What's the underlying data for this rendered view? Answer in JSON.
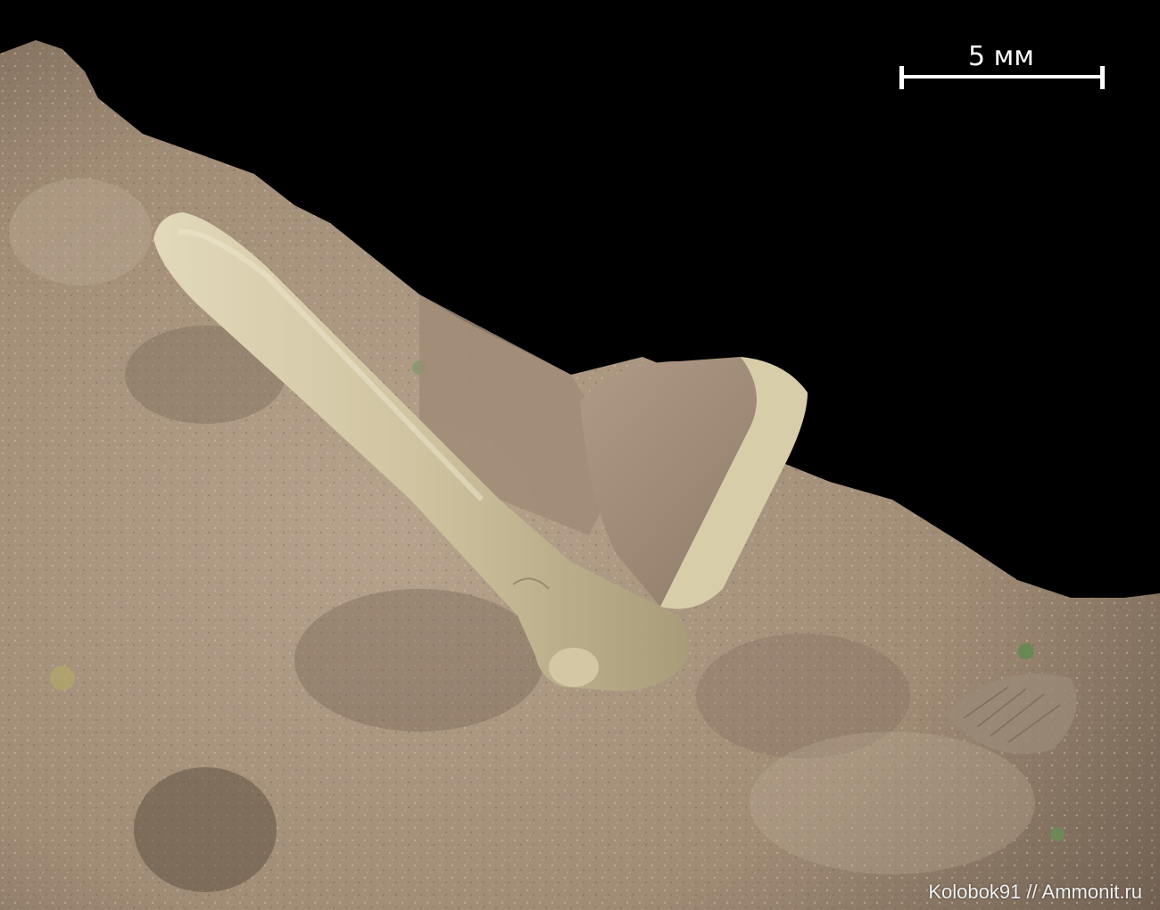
{
  "scale_bar": {
    "label": "5 мм",
    "color": "#ffffff"
  },
  "watermark": {
    "text": "Kolobok91 // Ammonit.ru"
  },
  "colors": {
    "background": "#000000",
    "matrix": "#a9957f",
    "matrix_shadow": "#7d6c5a",
    "matrix_light": "#c4b29c",
    "fossil": "#cfc3a0",
    "fossil_shade": "#a99c78",
    "fossil_light": "#e2d9bb",
    "fragment_pink": "#b39a84",
    "lichen": "#7f9a6a"
  },
  "icons": [
    "rock-matrix",
    "fossil-rod",
    "shell-fragment"
  ]
}
